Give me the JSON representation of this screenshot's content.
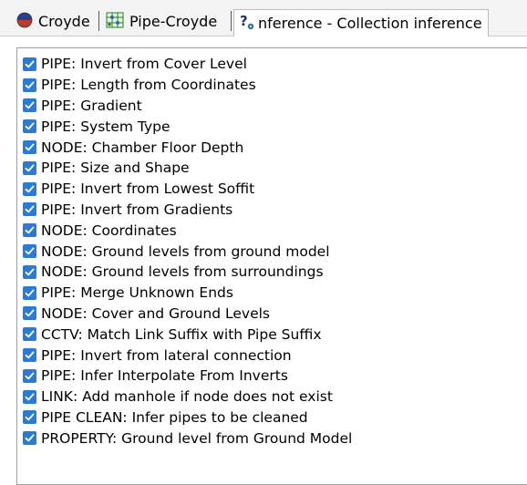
{
  "tabs": [
    {
      "label": "Croyde",
      "icon": "network-globe-icon"
    },
    {
      "label": "Pipe-Croyde",
      "icon": "grid-network-icon"
    },
    {
      "label": "nference - Collection inference",
      "icon": "inference-question-icon",
      "active": true
    }
  ],
  "colors": {
    "checkbox": "#2a7bd4",
    "tab_bar": "#f3f3f3"
  },
  "items": [
    {
      "label": "PIPE: Invert from Cover Level",
      "checked": true
    },
    {
      "label": "PIPE: Length from Coordinates",
      "checked": true
    },
    {
      "label": "PIPE: Gradient",
      "checked": true
    },
    {
      "label": "PIPE: System Type",
      "checked": true
    },
    {
      "label": "NODE: Chamber Floor Depth",
      "checked": true
    },
    {
      "label": "PIPE: Size and Shape",
      "checked": true
    },
    {
      "label": "PIPE: Invert from Lowest Soffit",
      "checked": true
    },
    {
      "label": "PIPE: Invert from Gradients",
      "checked": true
    },
    {
      "label": "NODE: Coordinates",
      "checked": true
    },
    {
      "label": "NODE: Ground levels from ground model",
      "checked": true
    },
    {
      "label": "NODE: Ground levels from surroundings",
      "checked": true
    },
    {
      "label": "PIPE: Merge Unknown Ends",
      "checked": true
    },
    {
      "label": "NODE: Cover and Ground Levels",
      "checked": true
    },
    {
      "label": "CCTV: Match Link Suffix with Pipe Suffix",
      "checked": true
    },
    {
      "label": "PIPE: Invert from lateral connection",
      "checked": true
    },
    {
      "label": "PIPE: Infer Interpolate From Inverts",
      "checked": true
    },
    {
      "label": "LINK: Add manhole if node does not exist",
      "checked": true
    },
    {
      "label": "PIPE CLEAN: Infer pipes to be cleaned",
      "checked": true
    },
    {
      "label": "PROPERTY: Ground level from Ground Model",
      "checked": true
    }
  ]
}
